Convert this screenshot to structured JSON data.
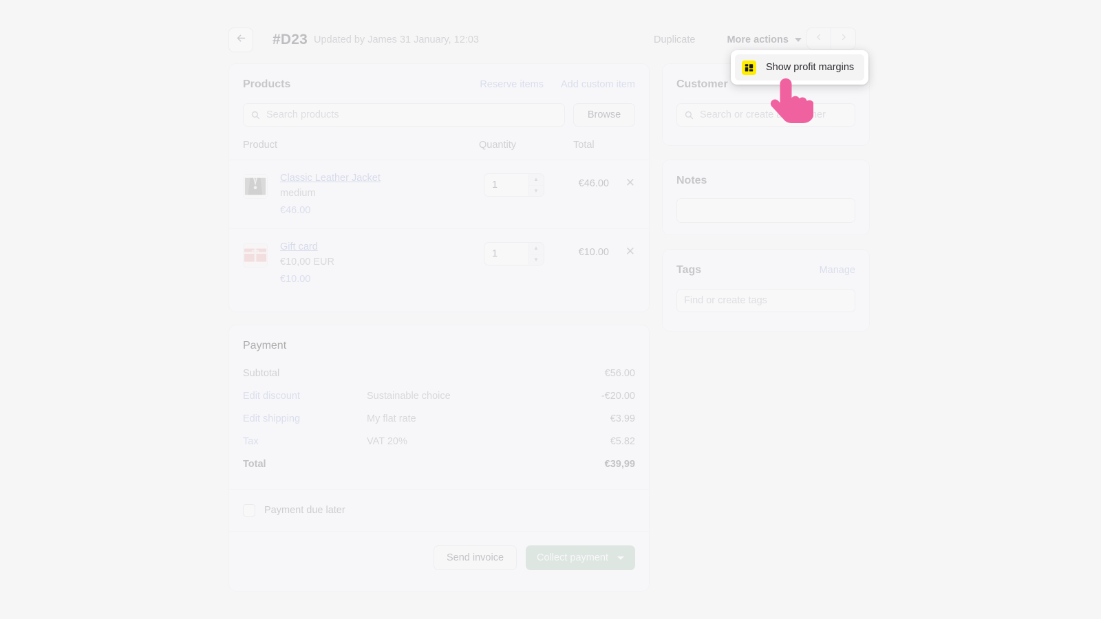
{
  "header": {
    "back_icon": "arrow-left-icon",
    "order_number": "#D23",
    "updated_text": "Updated by James 31 January, 12:03",
    "duplicate_label": "Duplicate",
    "more_actions_label": "More actions",
    "prev_icon": "chevron-left-icon",
    "next_icon": "chevron-right-icon"
  },
  "popover": {
    "icon": "profit-margins-icon",
    "icon_background": "#ffee00",
    "item_label": "Show profit margins"
  },
  "cursor": {
    "icon": "pointing-hand-cursor",
    "color": "#f0629f"
  },
  "products": {
    "title": "Products",
    "reserve_label": "Reserve items",
    "add_custom_label": "Add custom item",
    "search_placeholder": "Search products",
    "search_icon": "search-icon",
    "browse_label": "Browse",
    "columns": {
      "product": "Product",
      "quantity": "Quantity",
      "total": "Total"
    },
    "items": [
      {
        "thumb": "leather-jacket-photo",
        "title": "Classic Leather Jacket",
        "variant": "medium",
        "price": "€46.00",
        "quantity": "1",
        "total": "€46.00",
        "remove_icon": "close-icon"
      },
      {
        "thumb": "gift-card-image",
        "title": "Gift card",
        "variant": "€10,00 EUR",
        "price": "€10.00",
        "quantity": "1",
        "total": "€10.00",
        "remove_icon": "close-icon"
      }
    ]
  },
  "payment": {
    "title": "Payment",
    "rows": [
      {
        "label": "Subtotal",
        "desc": "",
        "amount": "€56.00",
        "link": false
      },
      {
        "label": "Edit discount",
        "desc": "Sustainable choice",
        "amount": "-€20.00",
        "link": true
      },
      {
        "label": "Edit shipping",
        "desc": "My flat rate",
        "amount": "€3.99",
        "link": true
      },
      {
        "label": "Tax",
        "desc": "VAT 20%",
        "amount": "€5.82",
        "link": true
      },
      {
        "label": "Total",
        "desc": "",
        "amount": "€39,99",
        "link": false
      }
    ],
    "due_later_label": "Payment due later",
    "due_later_checked": false,
    "send_invoice_label": "Send invoice",
    "collect_payment_label": "Collect payment",
    "collect_payment_color": "#a4c2b0"
  },
  "customer": {
    "title": "Customer",
    "search_icon": "search-icon",
    "search_placeholder": "Search or create a customer"
  },
  "notes": {
    "title": "Notes",
    "value": ""
  },
  "tags": {
    "title": "Tags",
    "manage_label": "Manage",
    "placeholder": "Find or create tags"
  }
}
